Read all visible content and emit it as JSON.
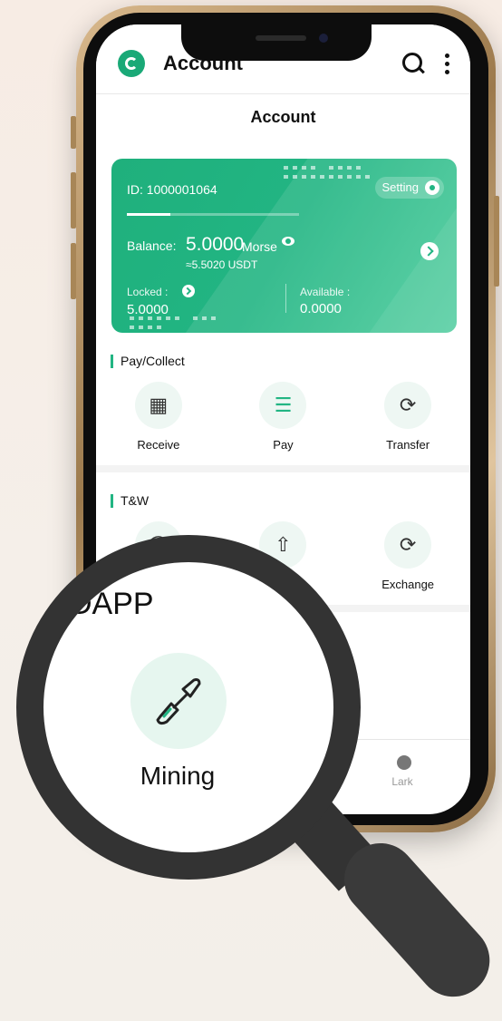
{
  "app": {
    "title": "Account",
    "page_title": "Account"
  },
  "card": {
    "id_text": "ID: 1000001064",
    "setting_label": "Setting",
    "balance_label": "Balance:",
    "balance_value": "5.0000",
    "balance_unit": "Morse",
    "balance_usdt": "≈5.5020 USDT",
    "locked_label": "Locked :",
    "locked_value": "5.0000",
    "available_label": "Available :",
    "available_value": "0.0000",
    "progress_fraction": 0.25,
    "color_start": "#1fb07c",
    "color_end": "#4ccc9c"
  },
  "sections": {
    "pay_collect": {
      "title": "Pay/Collect",
      "items": [
        {
          "label": "Receive",
          "icon": "qr-code-icon"
        },
        {
          "label": "Pay",
          "icon": "barcode-scan-icon"
        },
        {
          "label": "Transfer",
          "icon": "transfer-user-icon"
        }
      ]
    },
    "tw": {
      "title": "T&W",
      "items": [
        {
          "label": "",
          "icon": "deposit-icon"
        },
        {
          "label": "",
          "icon": "withdraw-upload-icon"
        },
        {
          "label": "Exchange",
          "icon": "exchange-user-icon"
        }
      ]
    }
  },
  "tabbar": {
    "lark_label": "Lark"
  },
  "magnifier": {
    "section_title": "DAPP",
    "item_label": "Mining",
    "item_icon": "shovel-icon"
  },
  "colors": {
    "accent": "#22b583",
    "phone_gold": "#b8966a",
    "background": "#f6eee7"
  }
}
